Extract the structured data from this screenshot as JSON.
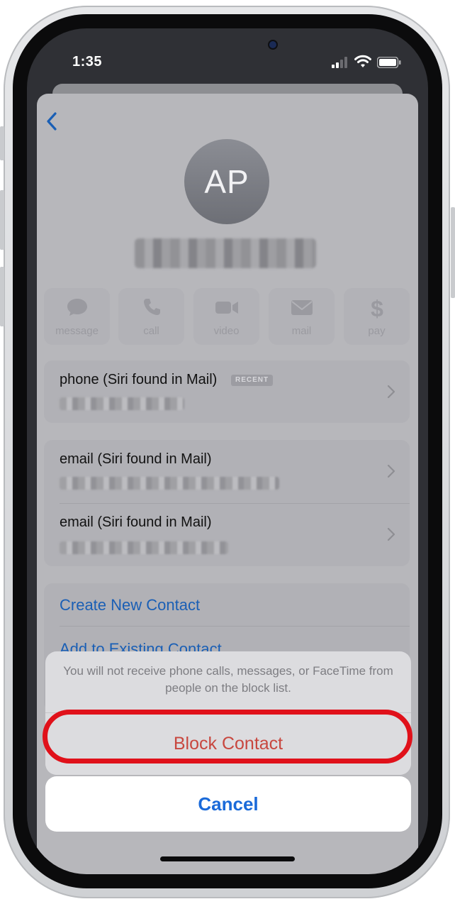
{
  "status_bar": {
    "time": "1:35"
  },
  "contact": {
    "initials": "AP"
  },
  "actions": [
    {
      "label": "message",
      "icon": "message-bubble-icon"
    },
    {
      "label": "call",
      "icon": "phone-icon"
    },
    {
      "label": "video",
      "icon": "video-camera-icon"
    },
    {
      "label": "mail",
      "icon": "envelope-icon"
    },
    {
      "label": "pay",
      "icon": "dollar-icon"
    }
  ],
  "phone_row": {
    "title": "phone (Siri found in Mail)",
    "badge": "RECENT"
  },
  "email_rows": [
    {
      "title": "email (Siri found in Mail)"
    },
    {
      "title": "email (Siri found in Mail)"
    }
  ],
  "links": {
    "create": "Create New Contact",
    "add_existing": "Add to Existing Contact"
  },
  "sheet": {
    "message": "You will not receive phone calls, messages, or FaceTime from people on the block list.",
    "block_label": "Block Contact",
    "cancel_label": "Cancel"
  },
  "colors": {
    "highlight": "#e0111a",
    "link": "#1a5fb5",
    "destructive": "#c8473f",
    "cancel": "#1a6ad9"
  }
}
